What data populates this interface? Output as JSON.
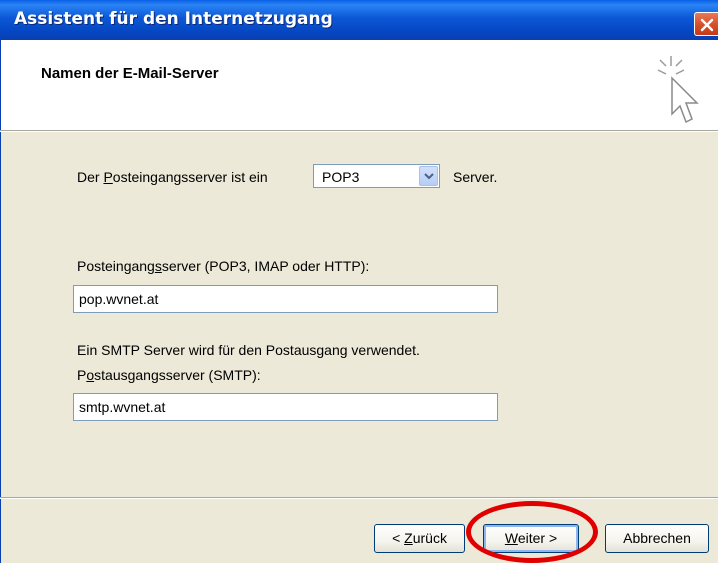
{
  "window": {
    "title": "Assistent für den Internetzugang"
  },
  "header": {
    "title": "Namen der E-Mail-Server"
  },
  "incoming_type": {
    "prefix": "Der ",
    "prefix_underlined": "P",
    "prefix_rest": "osteingangsserver ist ein",
    "selected": "POP3",
    "suffix": "Server."
  },
  "incoming_server": {
    "label_start": "Posteingang",
    "label_underlined": "s",
    "label_rest": "server (POP3, IMAP oder HTTP):",
    "value": "pop.wvnet.at"
  },
  "smtp_info": "Ein SMTP Server wird für den Postausgang verwendet.",
  "outgoing_server": {
    "label_start": "P",
    "label_underlined": "o",
    "label_rest": "stausgangsserver (SMTP):",
    "value": "smtp.wvnet.at"
  },
  "buttons": {
    "back_prefix": "< ",
    "back_underlined": "Z",
    "back_rest": "urück",
    "next_underlined": "W",
    "next_rest": "eiter >",
    "cancel": "Abbrechen"
  },
  "colors": {
    "title_bar": "#0b57d6",
    "dialog_bg": "#ece9d8",
    "highlight_ellipse": "#e00000"
  }
}
